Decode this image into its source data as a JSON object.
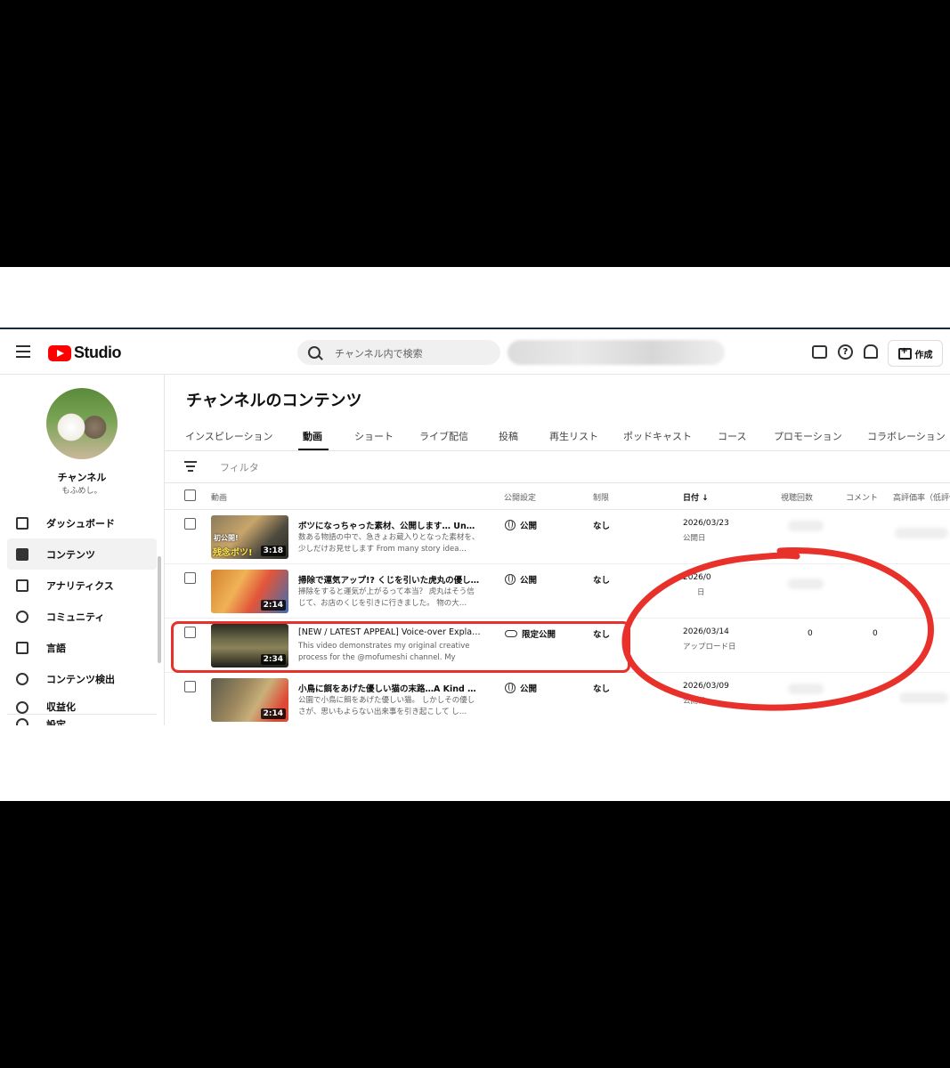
{
  "header": {
    "logo_text": "Studio",
    "search_placeholder": "チャンネル内で検索",
    "create_label": "作成"
  },
  "sidebar": {
    "channel_name": "チャンネル",
    "channel_handle": "もふめし。",
    "items": [
      {
        "label": "ダッシュボード",
        "icon": "dashboard-icon"
      },
      {
        "label": "コンテンツ",
        "icon": "content-icon",
        "active": true
      },
      {
        "label": "アナリティクス",
        "icon": "analytics-icon"
      },
      {
        "label": "コミュニティ",
        "icon": "community-icon"
      },
      {
        "label": "言語",
        "icon": "subtitles-icon"
      },
      {
        "label": "コンテンツ検出",
        "icon": "copyright-icon"
      },
      {
        "label": "収益化",
        "icon": "earn-icon"
      },
      {
        "label": "設定",
        "icon": "settings-icon"
      }
    ]
  },
  "main": {
    "title": "チャンネルのコンテンツ",
    "tabs": [
      "インスピレーション",
      "動画",
      "ショート",
      "ライブ配信",
      "投稿",
      "再生リスト",
      "ポッドキャスト",
      "コース",
      "プロモーション",
      "コラボレーション"
    ],
    "active_tab": "動画",
    "filter_placeholder": "フィルタ",
    "columns": {
      "video": "動画",
      "visibility": "公開設定",
      "restrictions": "制限",
      "date": "日付",
      "views": "視聴回数",
      "comments": "コメント",
      "likes": "高評価率（低評価"
    },
    "rows": [
      {
        "title": "ボツになっちゃった素材、公開します… Unuse…",
        "description": "数ある物語の中で、急きょお蔵入りとなった素材を、少しだけお見せします From many story idea…",
        "duration": "3:18",
        "thumb_caption_top": "初公開!",
        "thumb_caption_bottom": "残念ボツ!",
        "visibility": "公開",
        "restriction": "なし",
        "date": "2026/03/23",
        "date_type": "公開日"
      },
      {
        "title": "掃除で運気アップ!? くじを引いた虎丸の優し…",
        "description": "掃除をすると運気が上がるって本当？ 虎丸はそう信じて、お店のくじを引きに行きました。 物の大…",
        "duration": "2:14",
        "visibility": "公開",
        "restriction": "なし",
        "date": "2026/0",
        "date_type": "日"
      },
      {
        "title": "[NEW / LATEST APPEAL] Voice-over Explanatio…",
        "description": "This video demonstrates my original creative process for the @mofumeshi channel. My channe…",
        "duration": "2:34",
        "visibility": "限定公開",
        "restriction": "なし",
        "date": "2026/03/14",
        "date_type": "アップロード日",
        "views": "0",
        "comments": "0"
      },
      {
        "title": "小鳥に餌をあげた優しい猫の末路…A Kind Cat …",
        "description": "公園で小鳥に餌をあげた優しい猫。 しかしその優しさが、思いもよらない出来事を引き起こして し…",
        "duration": "2:14",
        "visibility": "公開",
        "restriction": "なし",
        "date": "2026/03/09",
        "date_type": "公開日"
      }
    ]
  },
  "colors": {
    "brand_red": "#ff0000",
    "annotation_red": "#e8312b"
  }
}
